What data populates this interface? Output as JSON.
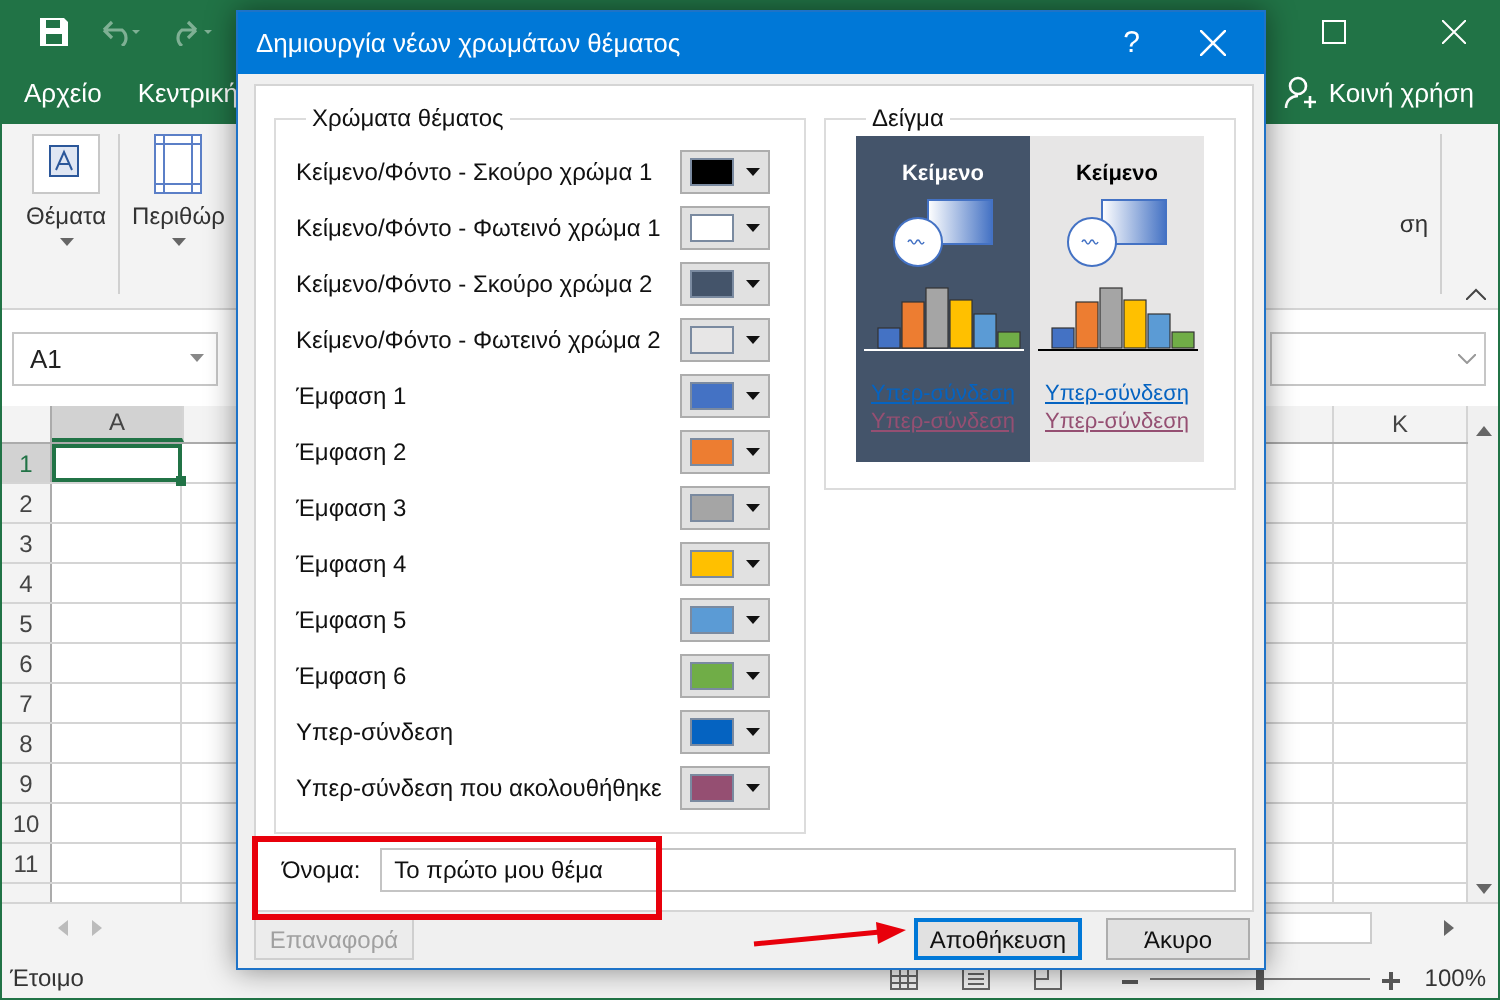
{
  "excel": {
    "tabs": [
      {
        "label": "Αρχείο"
      },
      {
        "label": "Κεντρική"
      }
    ],
    "share": "Κοινή χρήση",
    "ribbon": {
      "themes": "Θέματα",
      "margins": "Περιθώρ",
      "cut_label": "ση"
    },
    "name_box": "A1",
    "columns": [
      "A",
      "K"
    ],
    "rows": [
      {
        "label": "1",
        "selected": true
      },
      {
        "label": "2",
        "selected": false
      },
      {
        "label": "3",
        "selected": false
      },
      {
        "label": "4",
        "selected": false
      },
      {
        "label": "5",
        "selected": false
      },
      {
        "label": "6",
        "selected": false
      },
      {
        "label": "7",
        "selected": false
      },
      {
        "label": "8",
        "selected": false
      },
      {
        "label": "9",
        "selected": false
      },
      {
        "label": "10",
        "selected": false
      },
      {
        "label": "11",
        "selected": false
      }
    ],
    "status": "Έτοιμο",
    "zoom_slider": {
      "level": 0.5
    },
    "zoom": "100%"
  },
  "dialog": {
    "title": "Δημιουργία νέων χρωμάτων θέματος",
    "help": "?",
    "colors_group": "Χρώματα θέματος",
    "colors": [
      {
        "label": "Κείμενο/Φόντο - Σκούρο χρώμα 1",
        "color": "#000000"
      },
      {
        "label": "Κείμενο/Φόντο - Φωτεινό χρώμα 1",
        "color": "#ffffff"
      },
      {
        "label": "Κείμενο/Φόντο - Σκούρο χρώμα 2",
        "color": "#44546a"
      },
      {
        "label": "Κείμενο/Φόντο - Φωτεινό χρώμα 2",
        "color": "#e7e6e6"
      },
      {
        "label": "Έμφαση 1",
        "color": "#4472c4"
      },
      {
        "label": "Έμφαση 2",
        "color": "#ed7d31"
      },
      {
        "label": "Έμφαση 3",
        "color": "#a5a5a5"
      },
      {
        "label": "Έμφαση 4",
        "color": "#ffc000"
      },
      {
        "label": "Έμφαση 5",
        "color": "#5b9bd5"
      },
      {
        "label": "Έμφαση 6",
        "color": "#70ad47"
      },
      {
        "label": "Υπερ-σύνδεση",
        "color": "#0563c1"
      },
      {
        "label": "Υπερ-σύνδεση που ακολουθήθηκε",
        "color": "#954f72"
      }
    ],
    "sample_group": "Δείγμα",
    "sample_panels": [
      {
        "kind": "dark",
        "heading": "Κείμενο",
        "link": "Υπερ-σύνδεση",
        "followed_link": "Υπερ-σύνδεση"
      },
      {
        "kind": "light",
        "heading": "Κείμενο",
        "link": "Υπερ-σύνδεση",
        "followed_link": "Υπερ-σύνδεση"
      }
    ],
    "name_label": "Όνομα:",
    "name_value": "Το πρώτο μου θέμα",
    "buttons": [
      {
        "label": "Επαναφορά",
        "disabled": true,
        "default": false
      },
      {
        "label": "Αποθήκευση",
        "disabled": false,
        "default": true
      },
      {
        "label": "Άκυρο",
        "disabled": false,
        "default": false
      }
    ]
  }
}
